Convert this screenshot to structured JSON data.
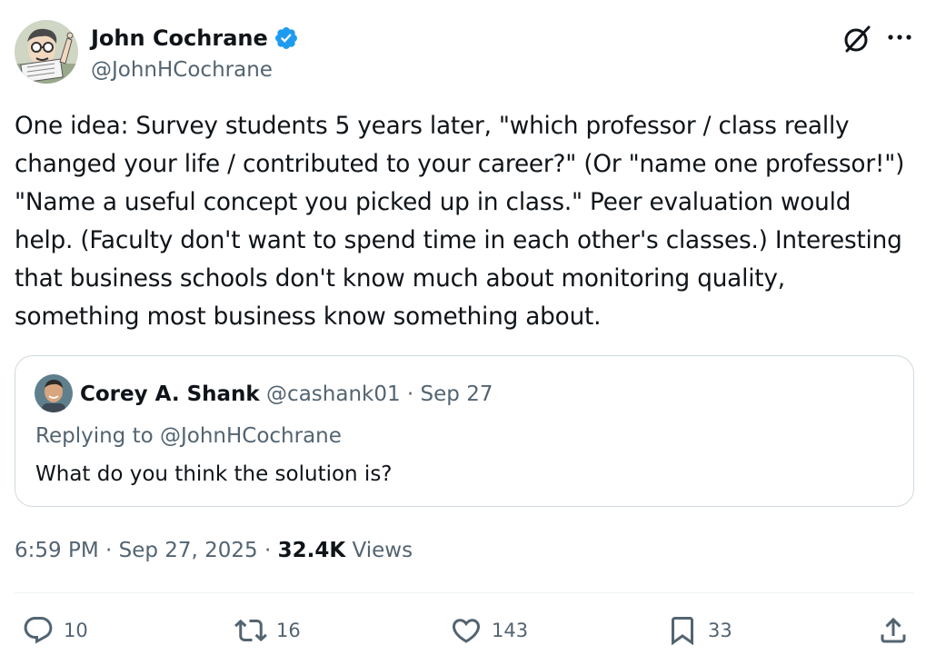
{
  "author": {
    "name": "John Cochrane",
    "handle": "@JohnHCochrane",
    "verified": true,
    "verified_color": "#1d9bf0"
  },
  "header_icons": [
    "grok-icon",
    "more-icon"
  ],
  "tweet": {
    "text": "One idea: Survey students 5 years later, \"which professor / class really\nchanged your life / contributed to your career?\" (Or \"name one professor!\")\n\"Name a useful concept you picked up in class.\" Peer evaluation would\nhelp. (Faculty don't want to spend time in each other's classes.) Interesting\nthat business schools don't know much about monitoring quality,\nsomething most business know something about."
  },
  "quote": {
    "name": "Corey A. Shank",
    "meta": "@cashank01 · Sep 27",
    "replying_to": "Replying to @JohnHCochrane",
    "text": "What do you think the solution is?"
  },
  "meta": {
    "time_date": "6:59 PM · Sep 27, 2025 · ",
    "views_count": "32.4K",
    "views_label": " Views"
  },
  "actions": {
    "replies": "10",
    "reposts": "16",
    "likes": "143",
    "bookmarks": "33"
  },
  "colors": {
    "text": "#0f1419",
    "secondary": "#536471",
    "border": "#cfd9de"
  }
}
